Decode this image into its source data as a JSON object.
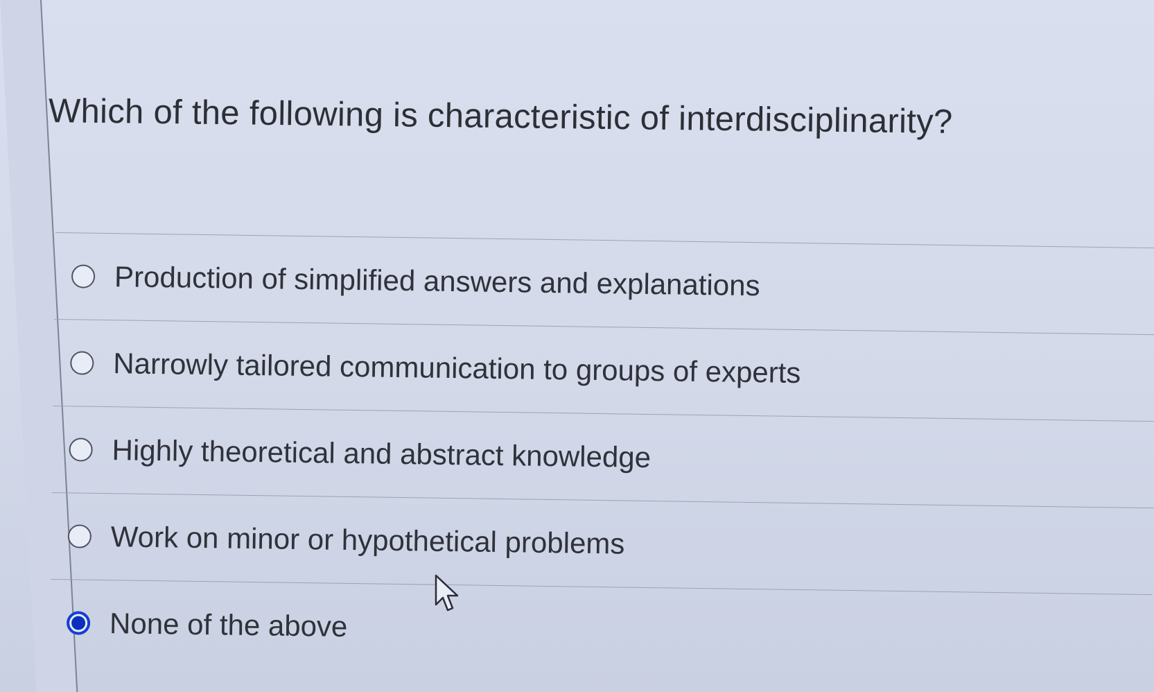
{
  "question": {
    "text": "Which of the following is characteristic of interdisciplinarity?"
  },
  "options": [
    {
      "label": "Production of simplified answers and explanations",
      "selected": false
    },
    {
      "label": "Narrowly tailored communication to groups of experts",
      "selected": false
    },
    {
      "label": "Highly theoretical and abstract knowledge",
      "selected": false
    },
    {
      "label": "Work on minor or hypothetical problems",
      "selected": false
    },
    {
      "label": "None of the above",
      "selected": true
    }
  ],
  "colors": {
    "accent": "#0d2fc0",
    "text": "#2f323a",
    "background": "#d6dcea"
  },
  "icons": {
    "cursor": "mouse-pointer-icon"
  }
}
